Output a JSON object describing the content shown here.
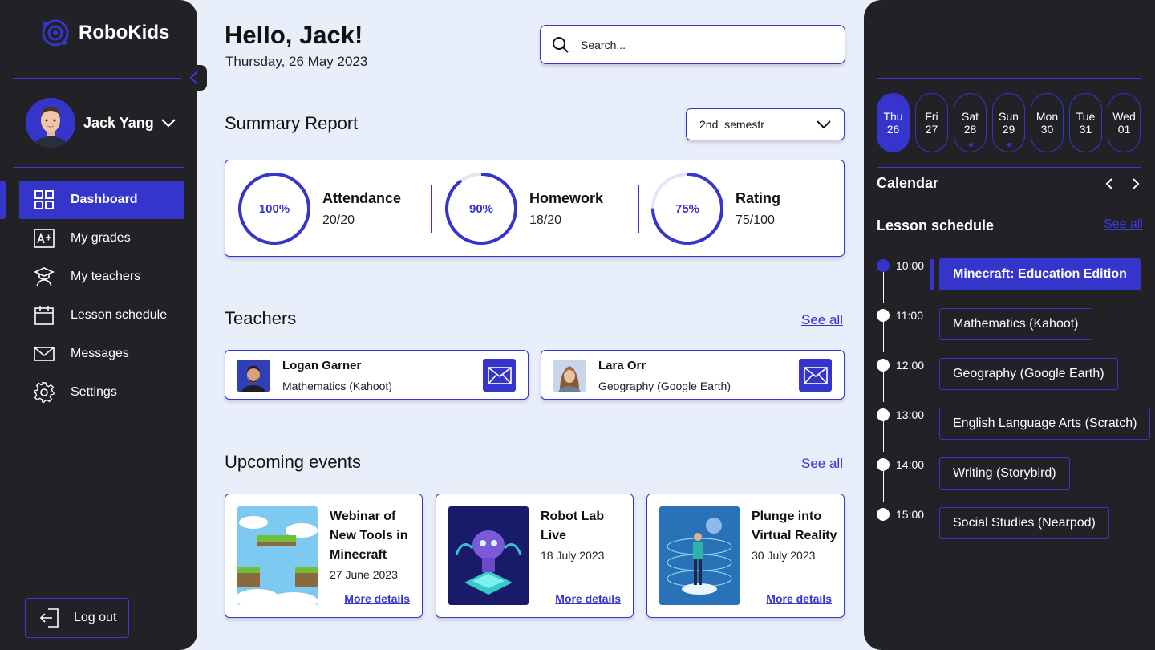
{
  "app": {
    "name": "RoboKids"
  },
  "user": {
    "name": "Jack Yang"
  },
  "nav": [
    {
      "label": "Dashboard",
      "icon": "grid-icon"
    },
    {
      "label": "My grades",
      "icon": "grade-icon"
    },
    {
      "label": "My teachers",
      "icon": "teacher-icon"
    },
    {
      "label": "Lesson schedule",
      "icon": "calendar-icon"
    },
    {
      "label": "Messages",
      "icon": "mail-icon"
    },
    {
      "label": "Settings",
      "icon": "gear-icon"
    }
  ],
  "logout": {
    "label": "Log out"
  },
  "header": {
    "greeting": "Hello, Jack!",
    "date": "Thursday, 26 May 2023"
  },
  "search": {
    "placeholder": "Search..."
  },
  "summary": {
    "title": "Summary Report",
    "semester": "2nd  semestr",
    "stats": [
      {
        "name": "Attendance",
        "value": "20/20",
        "percent_label": "100%",
        "percent": 100
      },
      {
        "name": "Homework",
        "value": "18/20",
        "percent_label": "90%",
        "percent": 90
      },
      {
        "name": "Rating",
        "value": "75/100",
        "percent_label": "75%",
        "percent": 75
      }
    ]
  },
  "teachers": {
    "title": "Teachers",
    "see_all": "See all",
    "items": [
      {
        "name": "Logan Garner",
        "subject": "Mathematics (Kahoot)"
      },
      {
        "name": "Lara Orr",
        "subject": "Geography (Google Earth)"
      }
    ]
  },
  "events": {
    "title": "Upcoming events",
    "see_all": "See all",
    "items": [
      {
        "title": "Webinar of New Tools in Minecraft",
        "date": "27 June 2023",
        "more": "More details"
      },
      {
        "title": "Robot Lab Live",
        "date": "18 July 2023",
        "more": "More details"
      },
      {
        "title": "Plunge into Virtual Reality",
        "date": "30 July 2023",
        "more": "More details"
      }
    ]
  },
  "calendar": {
    "title": "Calendar",
    "days": [
      {
        "dow": "Thu",
        "num": "26",
        "active": true,
        "dot": false
      },
      {
        "dow": "Fri",
        "num": "27",
        "active": false,
        "dot": false
      },
      {
        "dow": "Sat",
        "num": "28",
        "active": false,
        "dot": true
      },
      {
        "dow": "Sun",
        "num": "29",
        "active": false,
        "dot": true
      },
      {
        "dow": "Mon",
        "num": "30",
        "active": false,
        "dot": false
      },
      {
        "dow": "Tue",
        "num": "31",
        "active": false,
        "dot": false
      },
      {
        "dow": "Wed",
        "num": "01",
        "active": false,
        "dot": false
      }
    ]
  },
  "schedule": {
    "title": "Lesson schedule",
    "see_all": "See all",
    "lessons": [
      {
        "time": "10:00",
        "name": "Minecraft: Education Edition",
        "active": true
      },
      {
        "time": "11:00",
        "name": "Mathematics (Kahoot)",
        "active": false
      },
      {
        "time": "12:00",
        "name": "Geography (Google Earth)",
        "active": false
      },
      {
        "time": "13:00",
        "name": "English Language Arts (Scratch)",
        "active": false
      },
      {
        "time": "14:00",
        "name": "Writing (Storybird)",
        "active": false
      },
      {
        "time": "15:00",
        "name": "Social Studies (Nearpod)",
        "active": false
      }
    ]
  },
  "colors": {
    "accent": "#3535cc",
    "sidebar": "#222226",
    "background": "#e9eefb"
  }
}
